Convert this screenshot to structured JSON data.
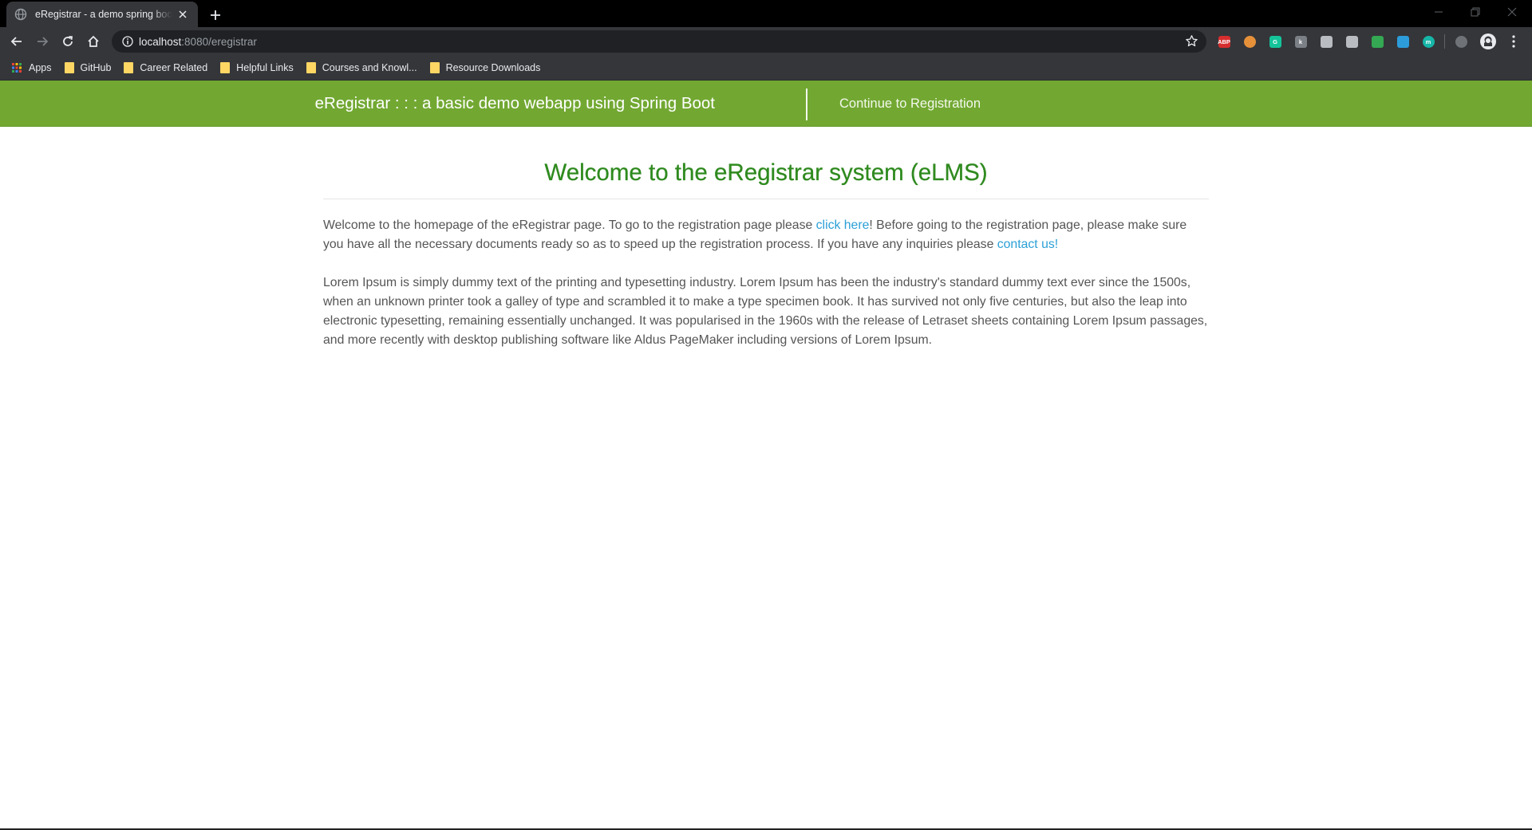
{
  "browser": {
    "tab_title": "eRegistrar - a demo spring boot webapp",
    "new_tab_label": "+",
    "url_host": "localhost",
    "url_rest": ":8080/eregistrar",
    "extensions": [
      {
        "name": "adblock-plus",
        "text": "ABP",
        "color": "#d62e2e"
      },
      {
        "name": "cookie",
        "text": "",
        "color": "#e6913a"
      },
      {
        "name": "grammarly",
        "text": "G",
        "color": "#15c39a"
      },
      {
        "name": "extension-k",
        "text": "k",
        "color": "#7b7f86"
      },
      {
        "name": "document",
        "text": "",
        "color": "#b9bcc1"
      },
      {
        "name": "cube",
        "text": "",
        "color": "#b9bcc1"
      },
      {
        "name": "leaf",
        "text": "",
        "color": "#34a853"
      },
      {
        "name": "cloud",
        "text": "",
        "color": "#2d9cdb"
      },
      {
        "name": "extension-m",
        "text": "m",
        "color": "#16b6a8"
      },
      {
        "name": "sync",
        "text": "",
        "color": "#6f7378"
      }
    ],
    "bookmarks": [
      {
        "label": "Apps",
        "kind": "apps"
      },
      {
        "label": "GitHub",
        "kind": "folder"
      },
      {
        "label": "Career Related",
        "kind": "folder"
      },
      {
        "label": "Helpful Links",
        "kind": "folder"
      },
      {
        "label": "Courses and Knowl...",
        "kind": "folder"
      },
      {
        "label": "Resource Downloads",
        "kind": "folder"
      }
    ]
  },
  "navbar": {
    "brand": "eRegistrar : : : a basic demo webapp using Spring Boot",
    "link": "Continue to Registration",
    "color": "#72a832"
  },
  "main": {
    "heading": "Welcome to the eRegistrar system (eLMS)",
    "intro": {
      "before_link1": "Welcome to the homepage of the eRegistrar page. To go to the registration page please ",
      "link1": "click here",
      "after_link1": "! Before going to the registration page, please make sure you have all the necessary documents ready so as to speed up the registration process. If you have any inquiries please ",
      "link2": "contact us!"
    },
    "lorem": "Lorem Ipsum is simply dummy text of the printing and typesetting industry. Lorem Ipsum has been the industry's standard dummy text ever since the 1500s, when an unknown printer took a galley of type and scrambled it to make a type specimen book. It has survived not only five centuries, but also the leap into electronic typesetting, remaining essentially unchanged. It was popularised in the 1960s with the release of Letraset sheets containing Lorem Ipsum passages, and more recently with desktop publishing software like Aldus PageMaker including versions of Lorem Ipsum."
  }
}
